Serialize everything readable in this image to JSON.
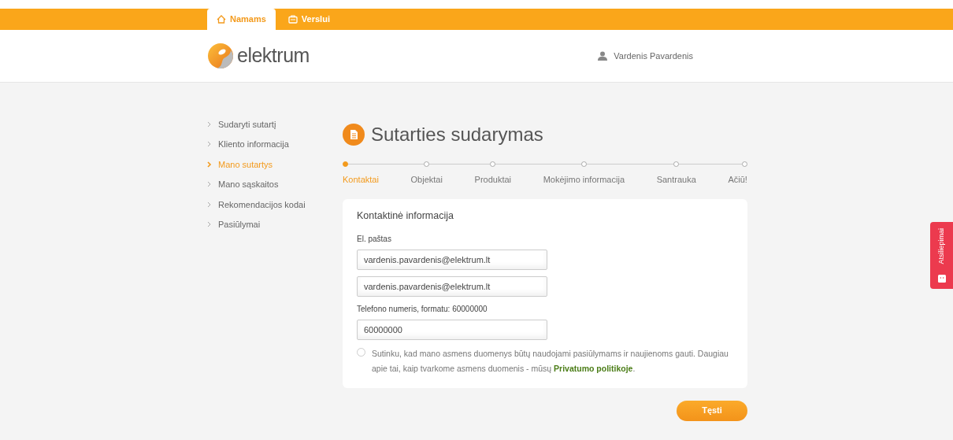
{
  "top_tabs": [
    {
      "label": "Namams",
      "selected": true
    },
    {
      "label": "Verslui",
      "selected": false
    }
  ],
  "logo": {
    "text": "elektrum"
  },
  "user": {
    "name": "Vardenis Pavardenis"
  },
  "sidebar": {
    "items": [
      {
        "label": "Sudaryti sutartį",
        "selected": false
      },
      {
        "label": "Kliento informacija",
        "selected": false
      },
      {
        "label": "Mano sutartys",
        "selected": true
      },
      {
        "label": "Mano sąskaitos",
        "selected": false
      },
      {
        "label": "Rekomendacijos kodai",
        "selected": false
      },
      {
        "label": "Pasiūlymai",
        "selected": false
      }
    ]
  },
  "page_title": "Sutarties sudarymas",
  "steps": [
    {
      "label": "Kontaktai",
      "selected": true
    },
    {
      "label": "Objektai",
      "selected": false
    },
    {
      "label": "Produktai",
      "selected": false
    },
    {
      "label": "Mokėjimo informacija",
      "selected": false
    },
    {
      "label": "Santrauka",
      "selected": false
    },
    {
      "label": "Ačiū!",
      "selected": false
    }
  ],
  "form": {
    "title": "Kontaktinė informacija",
    "fields": [
      {
        "label": "El. paštas",
        "value": "vardenis.pavardenis@elektrum.lt"
      },
      {
        "value": "vardenis.pavardenis@elektrum.lt"
      },
      {
        "label": "Telefono numeris, formatu: 60000000",
        "value": "60000000"
      }
    ],
    "consent": {
      "checked": false,
      "text": "Sutinku, kad mano asmens duomenys būtų naudojami pasiūlymams ir naujienoms gauti. Daugiau apie tai, kaip tvarkome asmens duomenis - mūsų",
      "link": "Privatumo politikoje",
      "suffix": "."
    }
  },
  "next_button": "Tęsti",
  "feedback_tab": "Atsiliepimai"
}
